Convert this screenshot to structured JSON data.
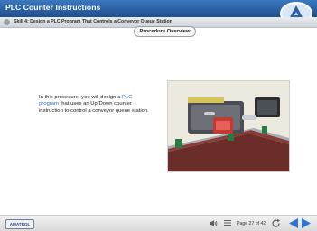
{
  "header": {
    "title": "PLC Counter Instructions",
    "brand_icon": "amatrol-a-logo-icon"
  },
  "subheader": {
    "title": "Skill 4: Design a PLC Program That Controls a Conveyor Queue Station"
  },
  "main": {
    "section_pill": "Procedure Overview",
    "text_parts": {
      "part1": "In this procedure, you will design a ",
      "link": "PLC program",
      "part2": " that uses an Up/Down counter instruction to control a conveyor queue station."
    },
    "image_alt": "Conveyor queue station equipment"
  },
  "footer": {
    "brand_label": "AMATROL",
    "page_text": "Page 27 of 42",
    "icons": {
      "sound": "speaker-icon",
      "menu": "menu-icon",
      "refresh": "refresh-icon",
      "prev": "left-arrow-icon",
      "next": "right-arrow-icon"
    }
  },
  "colors": {
    "accent": "#2a6fd0",
    "header_blue": "#2c63a8"
  }
}
